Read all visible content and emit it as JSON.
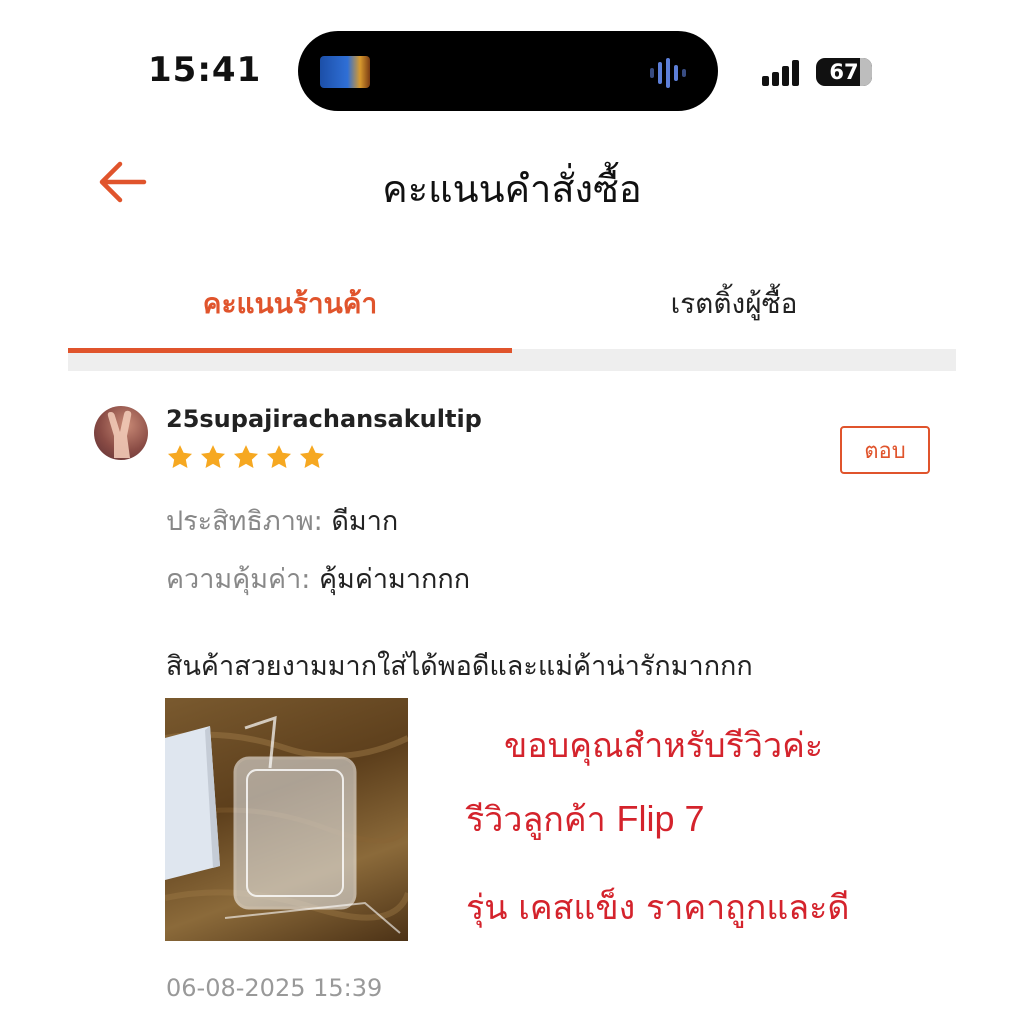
{
  "status_bar": {
    "time": "15:41",
    "battery": "67"
  },
  "header": {
    "title": "คะแนนคำสั่งซื้อ",
    "back_icon": "arrow-left-icon"
  },
  "tabs": [
    {
      "label": "คะแนนร้านค้า",
      "active": true
    },
    {
      "label": "เรตติ้งผู้ซื้อ",
      "active": false
    }
  ],
  "review": {
    "username": "25supajirachansakultip",
    "rating": 5,
    "reply_label": "ตอบ",
    "fields": [
      {
        "label": "ประสิทธิภาพ:",
        "value": "ดีมาก"
      },
      {
        "label": "ความคุ้มค่า:",
        "value": "คุ้มค่ามากกก"
      }
    ],
    "comment": "สินค้าสวยงามมากใส่ได้พอดีและแม่ค้าน่ารักมากกก",
    "overlay_text": {
      "line1": "ขอบคุณสำหรับรีวิวค่ะ",
      "line2_a": "รีวิวลูกค้า",
      "line2_b": "Flip 7",
      "line3": "รุ่น เคสแข็ง ราคาถูกและดี"
    },
    "date": "06-08-2025 15:39"
  },
  "colors": {
    "accent": "#e0542c",
    "star": "#f6a821",
    "overlay_red": "#d4232c"
  }
}
